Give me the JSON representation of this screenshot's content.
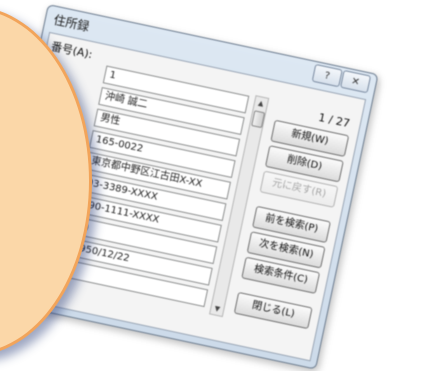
{
  "window": {
    "title": "住所録",
    "help_glyph": "?",
    "close_glyph": "✕"
  },
  "labels": {
    "number": "番号(A):"
  },
  "fields": [
    {
      "value": "1"
    },
    {
      "value": "沖崎 誠二"
    },
    {
      "value": "男性"
    },
    {
      "value": "165-0022"
    },
    {
      "value": "東京都中野区江古田X-XX"
    },
    {
      "value": "03-3389-XXXX"
    },
    {
      "value": "090-1111-XXXX"
    },
    {
      "value": "◯"
    },
    {
      "value": "1950/12/22"
    },
    {
      "value": ""
    }
  ],
  "scroll": {
    "up_glyph": "▲",
    "down_glyph": "▼"
  },
  "record_counter": "1 / 27",
  "buttons": {
    "new": "新規(W)",
    "delete": "削除(D)",
    "restore": "元に戻す(R)",
    "find_prev": "前を検索(P)",
    "find_next": "次を検索(N)",
    "criteria": "検索条件(C)",
    "close": "閉じる(L)"
  },
  "colors": {
    "overlay_fill": "#fbd7a8",
    "overlay_border": "#f2a45a"
  }
}
